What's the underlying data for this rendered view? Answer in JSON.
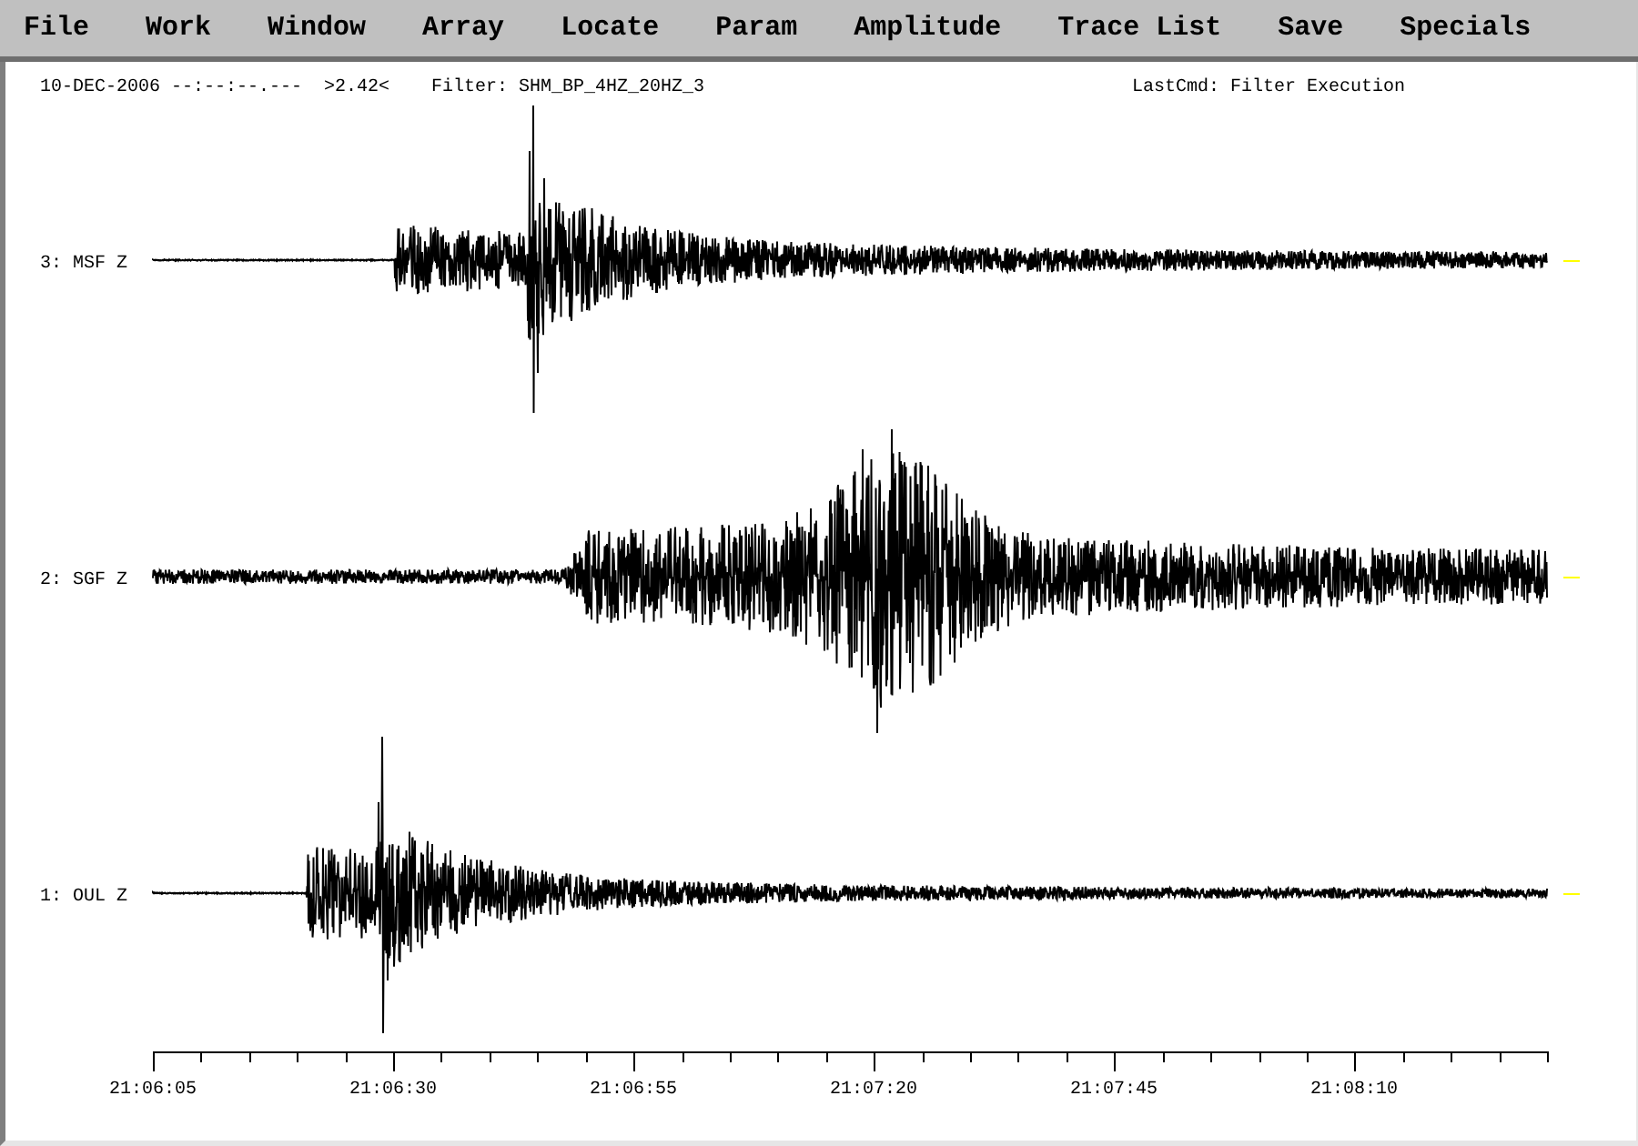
{
  "menu_bar": {
    "items": [
      "File",
      "Work",
      "Window",
      "Array",
      "Locate",
      "Param",
      "Amplitude",
      "Trace List",
      "Save",
      "Specials"
    ]
  },
  "status_line": {
    "date_time": "10-DEC-2006 --:--:--.---",
    "scale": ">2.42<",
    "filter": "Filter: SHM_BP_4HZ_20HZ_3",
    "last_command": "LastCmd: Filter Execution"
  },
  "traces": [
    {
      "label": "3: MSF Z"
    },
    {
      "label": "2: SGF Z"
    },
    {
      "label": "1: OUL Z"
    }
  ],
  "time_axis": {
    "tick_labels": [
      "21:06:05",
      "21:06:30",
      "21:06:55",
      "21:07:20",
      "21:07:45",
      "21:08:10"
    ]
  }
}
